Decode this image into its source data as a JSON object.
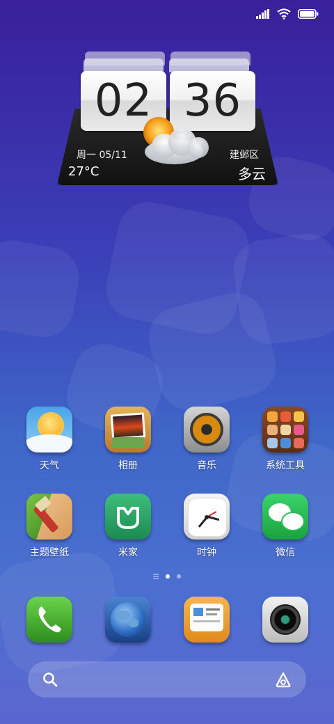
{
  "status_bar": {
    "signal_icon": "signal-icon",
    "wifi_icon": "wifi-icon",
    "battery_icon": "battery-icon"
  },
  "widget": {
    "hours": "02",
    "minutes": "36",
    "date": "周一  05/11",
    "location": "建邺区",
    "temperature": "27°C",
    "condition": "多云",
    "weather_icon": "partly-cloudy-icon"
  },
  "apps_row1": [
    {
      "label": "天气",
      "icon": "weather-icon"
    },
    {
      "label": "相册",
      "icon": "gallery-icon"
    },
    {
      "label": "音乐",
      "icon": "music-icon"
    },
    {
      "label": "系统工具",
      "icon": "system-tools-icon"
    }
  ],
  "apps_row2": [
    {
      "label": "主题壁纸",
      "icon": "theme-icon"
    },
    {
      "label": "米家",
      "icon": "mijia-icon"
    },
    {
      "label": "时钟",
      "icon": "clock-icon"
    },
    {
      "label": "微信",
      "icon": "wechat-icon"
    }
  ],
  "dock": [
    {
      "icon": "phone-icon"
    },
    {
      "icon": "browser-icon"
    },
    {
      "icon": "messages-icon"
    },
    {
      "icon": "camera-icon"
    }
  ],
  "page_indicator": {
    "pages": 2,
    "current": 1
  },
  "search_bar": {
    "search_icon": "search-icon",
    "assistant_icon": "assistant-icon"
  }
}
